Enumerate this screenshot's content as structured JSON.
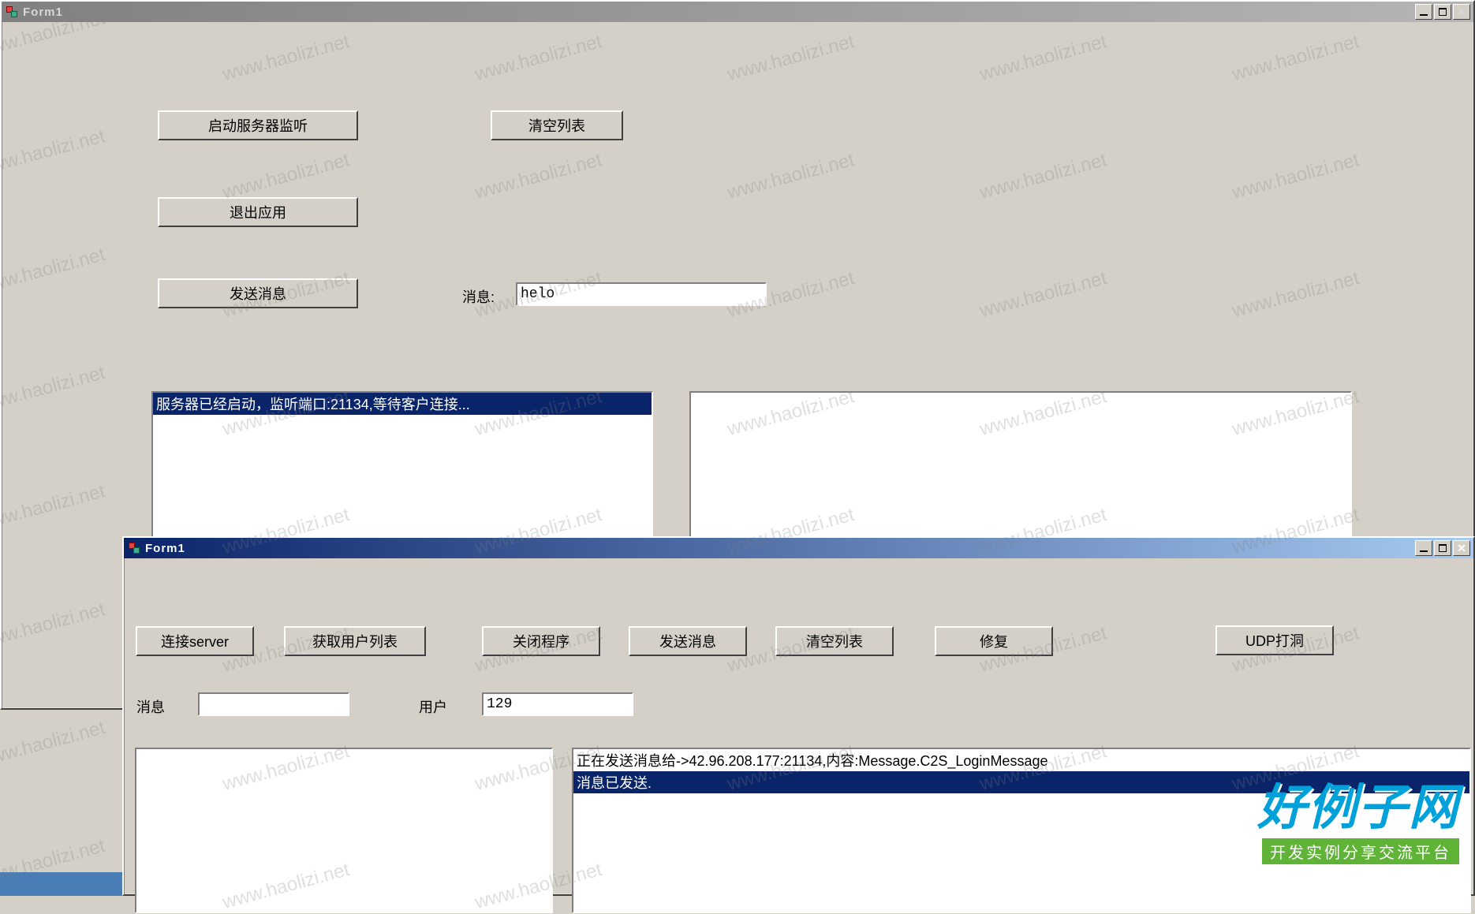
{
  "watermark_text": "www.haolizi.net",
  "window1": {
    "title": "Form1",
    "buttons": {
      "start_server": "启动服务器监听",
      "clear_list": "清空列表",
      "exit_app": "退出应用",
      "send_msg": "发送消息"
    },
    "message_label": "消息:",
    "message_value": "helo",
    "listbox_item": "服务器已经启动，监听端口:21134,等待客户连接..."
  },
  "window2": {
    "title": "Form1",
    "buttons": {
      "connect_server": "连接server",
      "get_user_list": "获取用户列表",
      "close_program": "关闭程序",
      "send_msg": "发送消息",
      "clear_list": "清空列表",
      "repair": "修复",
      "udp_punch": "UDP打洞"
    },
    "message_label": "消息",
    "message_value": "",
    "user_label": "用户",
    "user_value": "129",
    "log_line1": "正在发送消息给->42.96.208.177:21134,内容:Message.C2S_LoginMessage",
    "log_line2": "消息已发送."
  },
  "site_logo": {
    "main": "好例子网",
    "sub": "开发实例分享交流平台"
  }
}
